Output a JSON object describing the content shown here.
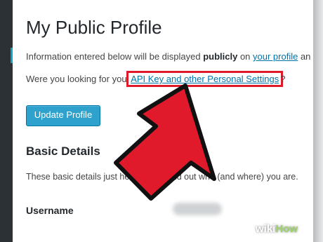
{
  "page": {
    "title": "My Public Profile",
    "info_text_pre": "Information entered below will be displayed ",
    "info_text_bold": "publicly",
    "info_text_mid": " on ",
    "info_link": "your profile",
    "info_text_post": " an",
    "looking_text": "Were you looking for you",
    "looking_link": "API Key and other Personal Settings",
    "looking_post": "?",
    "update_button": "Update Profile"
  },
  "basic_details": {
    "heading": "Basic Details",
    "description": "These basic details just help people find out who (and where) you are.",
    "username_label": "Username"
  },
  "annotation": {
    "arrow_color": "#e0192b",
    "highlight_color": "#e0192b"
  },
  "watermark": {
    "part1": "wiki",
    "part2": "How"
  }
}
